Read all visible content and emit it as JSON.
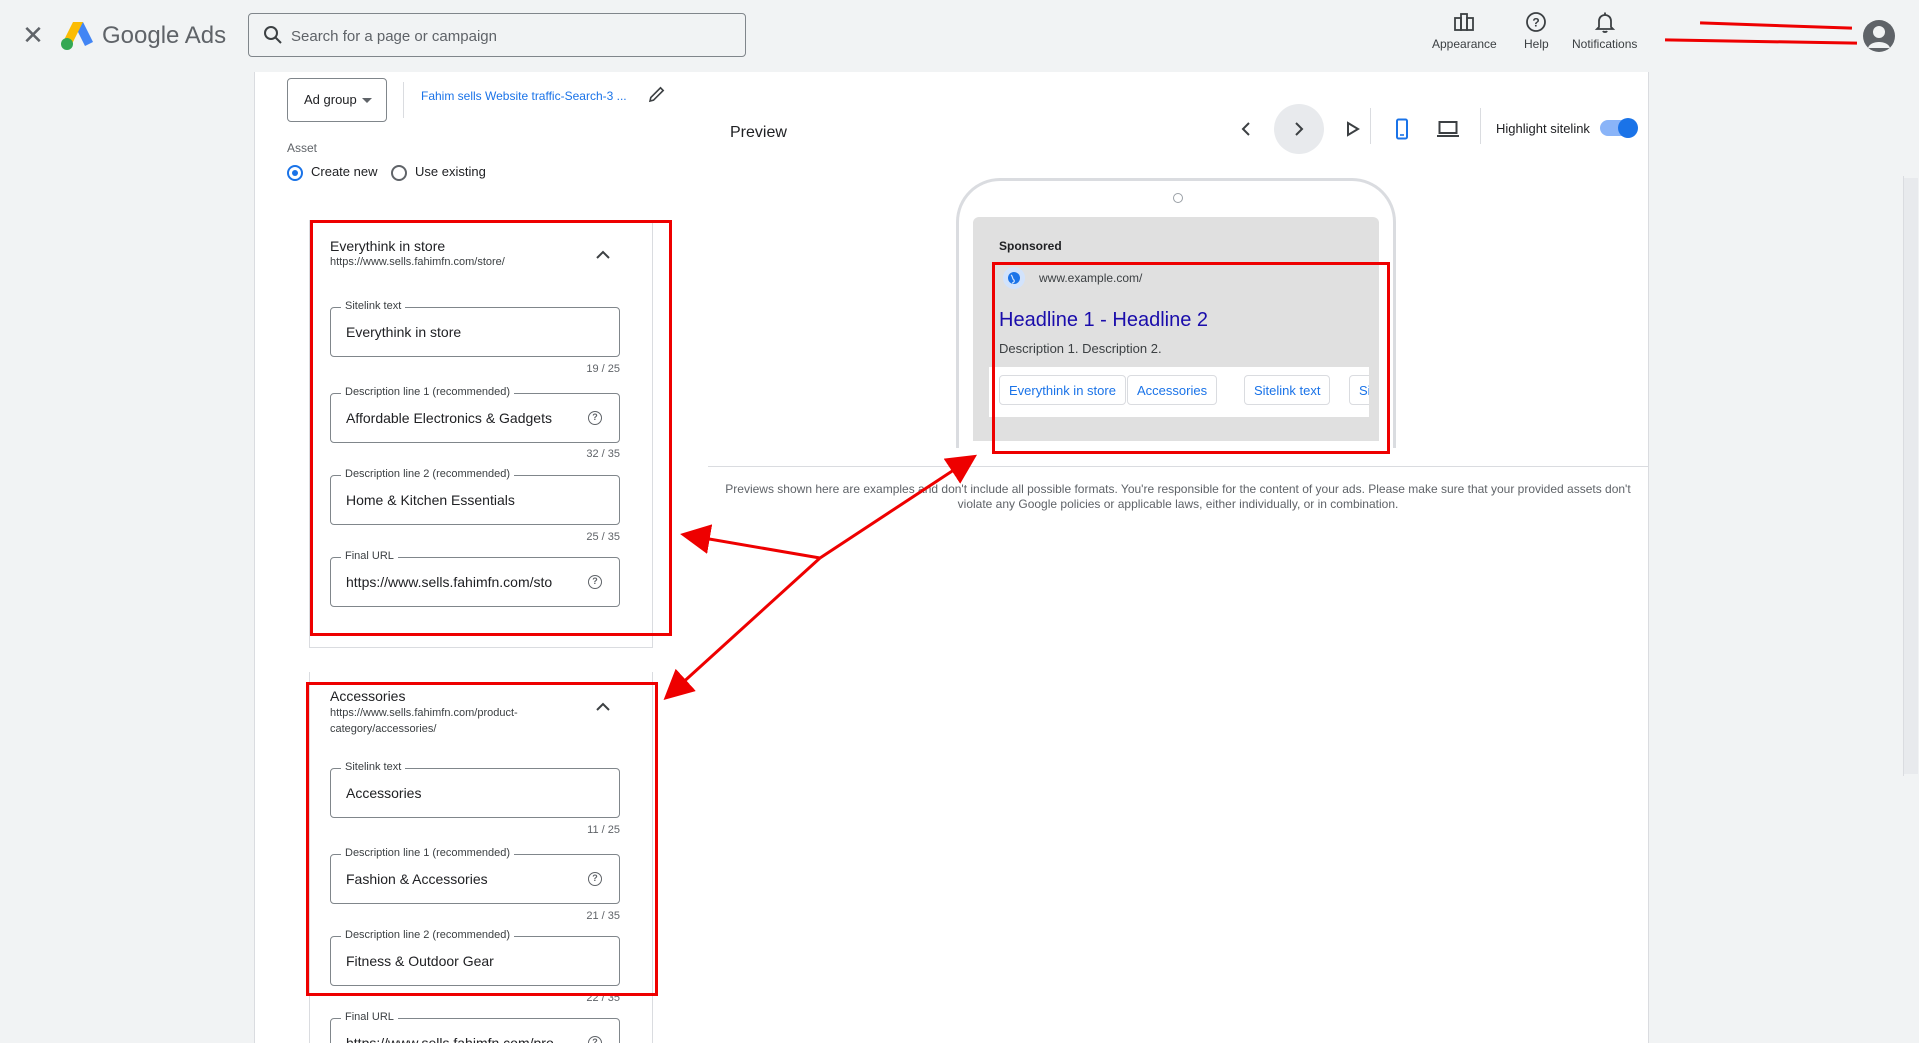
{
  "app": {
    "brand": "Google Ads",
    "accent": "#1a73e8"
  },
  "topbar": {
    "search_placeholder": "Search for a page or campaign",
    "appearance_label": "Appearance",
    "help_label": "Help",
    "notifications_label": "Notifications"
  },
  "editor": {
    "adgroup_label": "Ad group",
    "campaign_link": "Fahim sells Website traffic-Search-3 ...",
    "asset_label": "Asset",
    "create_new_label": "Create new",
    "use_existing_label": "Use existing",
    "cards": [
      {
        "title": "Everythink in store",
        "url": "https://www.sells.fahimfn.com/store/",
        "fields": [
          {
            "label": "Sitelink text",
            "value": "Everythink in store",
            "counter": "19 / 25"
          },
          {
            "label": "Description line 1 (recommended)",
            "value": "Affordable Electronics & Gadgets",
            "counter": "32 / 35"
          },
          {
            "label": "Description line 2 (recommended)",
            "value": "Home & Kitchen Essentials",
            "counter": "25 / 35"
          },
          {
            "label": "Final URL",
            "value": "https://www.sells.fahimfn.com/sto",
            "counter": ""
          }
        ]
      },
      {
        "title": "Accessories",
        "url": "https://www.sells.fahimfn.com/product-category/accessories/",
        "fields": [
          {
            "label": "Sitelink text",
            "value": "Accessories",
            "counter": "11 / 25"
          },
          {
            "label": "Description line 1 (recommended)",
            "value": "Fashion & Accessories",
            "counter": "21 / 35"
          },
          {
            "label": "Description line 2 (recommended)",
            "value": "Fitness & Outdoor Gear",
            "counter": "22 / 35"
          },
          {
            "label": "Final URL",
            "value": "https://www.sells.fahimfn.com/pro",
            "counter": ""
          }
        ]
      }
    ]
  },
  "preview": {
    "title": "Preview",
    "highlight_label": "Highlight sitelink",
    "highlight_on": true,
    "sponsored": "Sponsored",
    "display_url": "www.example.com/",
    "headline": "Headline 1 - Headline 2",
    "description": "Description 1. Description 2.",
    "sitelinks": [
      "Everythink in store",
      "Accessories",
      "Sitelink text",
      "Si"
    ],
    "disclaimer": "Previews shown here are examples and don't include all possible formats. You're responsible for the content of your ads. Please make sure that your provided assets don't violate any Google policies or applicable laws, either individually, or in combination."
  },
  "annotation_color": "#e00000"
}
